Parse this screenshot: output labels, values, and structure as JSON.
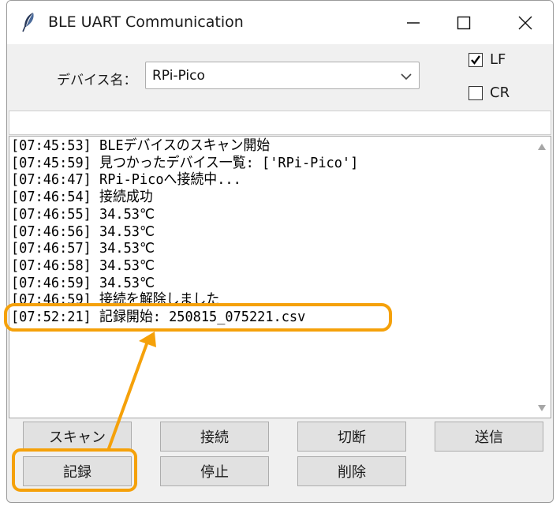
{
  "window": {
    "title": "BLE UART Communication"
  },
  "device": {
    "label": "デバイス名：",
    "selected": "RPi-Pico"
  },
  "options": [
    {
      "label": "LF",
      "checked": true
    },
    {
      "label": "CR",
      "checked": false
    }
  ],
  "send_input": {
    "value": ""
  },
  "log": {
    "lines": [
      "[07:45:53] BLEデバイスのスキャン開始",
      "[07:45:59] 見つかったデバイス一覧: ['RPi-Pico']",
      "[07:46:47]  RPi-Picoへ接続中...",
      "[07:46:54] 接続成功",
      "[07:46:55] 34.53℃",
      "[07:46:56] 34.53℃",
      "[07:46:57] 34.53℃",
      "[07:46:58] 34.53℃",
      "[07:46:59] 34.53℃",
      "[07:46:59] 接続を解除しました",
      "[07:52:21] 記録開始: 250815_075221.csv"
    ]
  },
  "buttons": {
    "scan": "スキャン",
    "connect": "接続",
    "disconnect": "切断",
    "send": "送信",
    "record": "記録",
    "stop": "停止",
    "clear": "削除"
  },
  "colors": {
    "annotation": "#f5a10a",
    "window_bg": "#f0f0f0",
    "button_bg": "#e1e1e1"
  },
  "icons": [
    "feather-icon",
    "minimize-icon",
    "maximize-icon",
    "close-icon",
    "chevron-down-icon",
    "checkmark-icon",
    "scroll-up-arrow-icon",
    "scroll-down-arrow-icon"
  ]
}
